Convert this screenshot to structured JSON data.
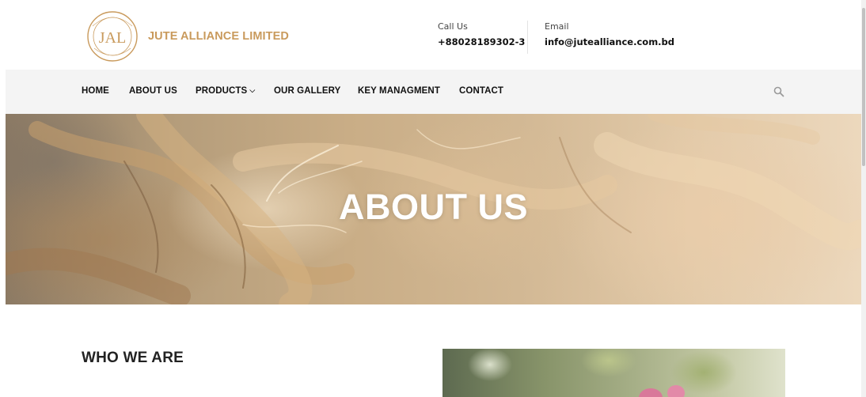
{
  "header": {
    "logo_icon": "jal-seal-logo",
    "brand_name": "JUTE ALLIANCE LIMITED",
    "call": {
      "label": "Call Us",
      "value": "+88028189302-3"
    },
    "email": {
      "label": "Email",
      "value": "info@jutealliance.com.bd"
    },
    "colors": {
      "brand": "#c99a5c",
      "nav_bg": "#f4f4f4"
    }
  },
  "nav": {
    "items": [
      {
        "label": "HOME"
      },
      {
        "label": "ABOUT US"
      },
      {
        "label": "PRODUCTS",
        "dropdown": true
      },
      {
        "label": "OUR GALLERY"
      },
      {
        "label": "KEY MANAGMENT"
      },
      {
        "label": "CONTACT"
      }
    ],
    "dropdown_icon": "chevron-down-icon",
    "search_icon": "search-icon"
  },
  "hero": {
    "title": "ABOUT US"
  },
  "content": {
    "section_title": "WHO WE ARE"
  }
}
